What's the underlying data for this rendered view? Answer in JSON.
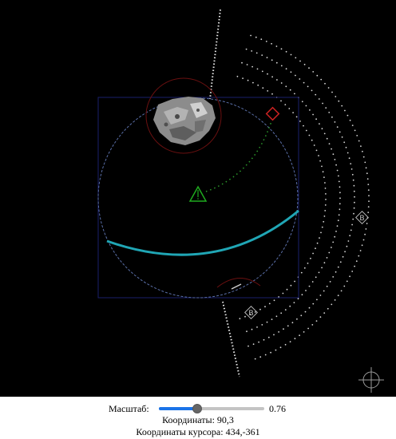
{
  "controls": {
    "scale_label": "Масштаб:",
    "scale_value": "0.76",
    "scale_fraction": 0.36,
    "coords_label": "Координаты: 90,3",
    "cursor_coords_label": "Координаты курсора: 434,-361"
  },
  "markers": {
    "beacon_right": "B",
    "beacon_lower": "B"
  },
  "colors": {
    "background": "#000000",
    "frame": "#1a1f6b",
    "planet_outline": "#5a6fa8",
    "track": "#20a6b5",
    "ship": "#1faa1f",
    "target": "#cc2222",
    "trail": "#2c9a2c",
    "dots": "#e8e8e8"
  }
}
